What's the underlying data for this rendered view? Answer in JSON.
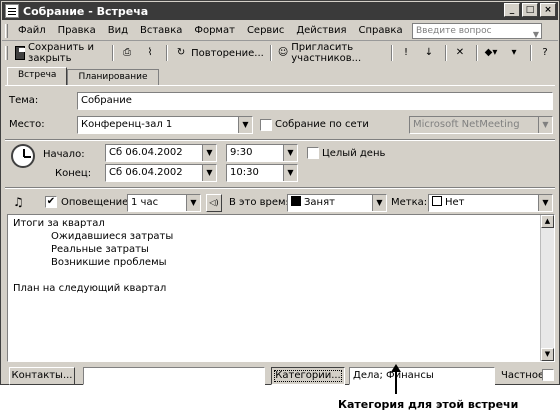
{
  "window": {
    "title": "Собрание - Встреча",
    "buttons": [
      "_",
      "□",
      "×"
    ]
  },
  "menu": {
    "items": [
      "Файл",
      "Правка",
      "Вид",
      "Вставка",
      "Формат",
      "Сервис",
      "Действия",
      "Справка"
    ],
    "ask_placeholder": "Введите вопрос"
  },
  "toolbar": {
    "save_close": "Сохранить и закрыть",
    "recurrence": "Повторение...",
    "invite": "Пригласить участников...",
    "help_icon": "?"
  },
  "tabs": [
    "Встреча",
    "Планирование"
  ],
  "form": {
    "subject_label": "Тема:",
    "subject_value": "Собрание",
    "location_label": "Место:",
    "location_value": "Конференц-зал 1",
    "online_label": "Собрание по сети",
    "online_service": "Microsoft NetMeeting",
    "start_label": "Начало:",
    "start_date": "Сб 06.04.2002",
    "start_time": "9:30",
    "allday_label": "Целый день",
    "end_label": "Конец:",
    "end_date": "Сб 06.04.2002",
    "end_time": "10:30",
    "reminder_label": "Оповещение:",
    "reminder_checked": "✔",
    "reminder_value": "1 час",
    "showas_label": "В это время:",
    "showas_value": "Занят",
    "label_label": "Метка:",
    "label_value": "Нет"
  },
  "body_lines": [
    "Итоги за квартал",
    "Ожидавшиеся затраты",
    "Реальные затраты",
    "Возникшие проблемы",
    "",
    "План на следующий квартал"
  ],
  "bottom": {
    "contacts_button": "Контакты...",
    "categories_button": "Категории...",
    "categories_value": "Дела; Финансы",
    "private_label": "Частное"
  },
  "caption": "Категория для этой встречи"
}
